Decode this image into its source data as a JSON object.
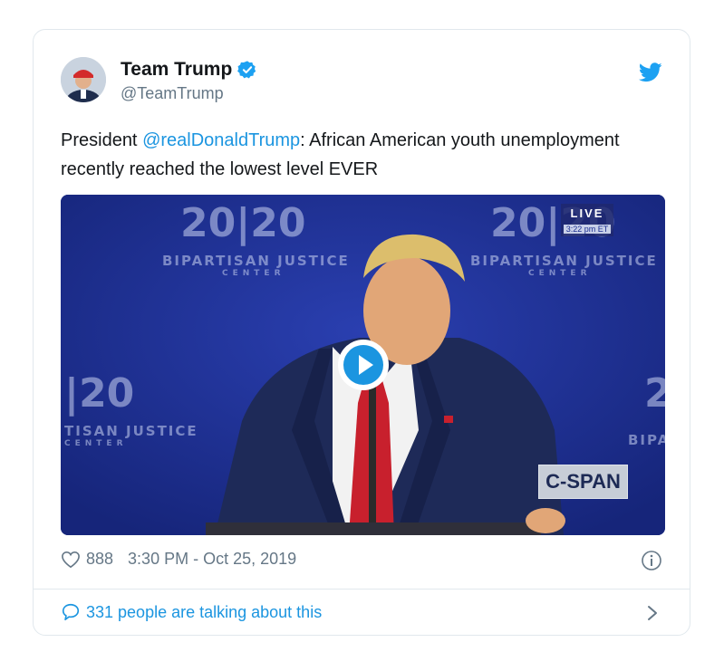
{
  "tweet": {
    "author_name": "Team Trump",
    "author_handle": "@TeamTrump",
    "text_before": "President ",
    "mention": "@realDonaldTrump",
    "text_after": ": African American youth unemployment recently reached the lowest level EVER",
    "likes": "888",
    "timestamp": "3:30 PM - Oct 25, 2019",
    "talking_text": "331 people are talking about this"
  },
  "video": {
    "backdrop_logo": "20|20",
    "backdrop_title": "BIPARTISAN JUSTICE",
    "backdrop_sub": "CENTER",
    "backdrop_left_logo": "|20",
    "backdrop_left_title": "TISAN JUSTICE",
    "backdrop_right_fragment": "2",
    "backdrop_right_title": "BIPA",
    "live_label": "LIVE",
    "live_time": "3:22 pm ET",
    "network_badge": "C-SPAN"
  },
  "icons": {
    "verified": "verified-badge-icon",
    "bird": "twitter-bird-icon",
    "heart": "heart-icon",
    "info": "info-icon",
    "reply": "speech-bubble-icon",
    "chevron": "chevron-right-icon",
    "play": "play-icon"
  },
  "colors": {
    "link": "#1b95e0",
    "muted": "#657786",
    "video_bg": "#1c2f91"
  }
}
